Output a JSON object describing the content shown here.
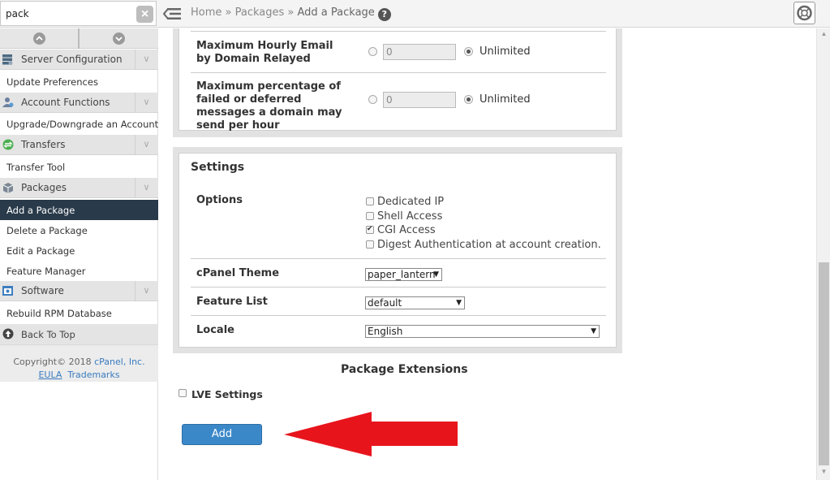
{
  "search": {
    "value": "pack",
    "clear_icon": "×"
  },
  "breadcrumb": {
    "home": "Home",
    "sep1": " » ",
    "packages": "Packages",
    "sep2": " » ",
    "current": "Add a Package",
    "help": "?"
  },
  "sidebar": {
    "categories": [
      {
        "label": "Server Configuration",
        "icon": "server-icon"
      },
      {
        "label": "Account Functions",
        "icon": "user-icon"
      },
      {
        "label": "Transfers",
        "icon": "transfer-icon"
      },
      {
        "label": "Packages",
        "icon": "package-icon"
      },
      {
        "label": "Software",
        "icon": "software-icon"
      }
    ],
    "items": {
      "update_preferences": "Update Preferences",
      "upgrade_downgrade": "Upgrade/Downgrade an Account",
      "transfer_tool": "Transfer Tool",
      "add_package": "Add a Package",
      "delete_package": "Delete a Package",
      "edit_package": "Edit a Package",
      "feature_manager": "Feature Manager",
      "rebuild_rpm": "Rebuild RPM Database"
    },
    "back_to_top": "Back To Top",
    "chevron": "∨",
    "footer": {
      "copyright": "Copyright© 2018 ",
      "company": "cPanel, Inc.",
      "eula": "EULA",
      "trademarks": "Trademarks"
    }
  },
  "email_limits": {
    "rows": [
      {
        "label": "Maximum Hourly Email by Domain Relayed",
        "value": "0",
        "option": "Unlimited"
      },
      {
        "label": "Maximum percentage of failed or deferred messages a domain may send per hour",
        "value": "0",
        "option": "Unlimited"
      }
    ]
  },
  "settings": {
    "title": "Settings",
    "options_label": "Options",
    "options": [
      {
        "label": "Dedicated IP",
        "checked": false
      },
      {
        "label": "Shell Access",
        "checked": false
      },
      {
        "label": "CGI Access",
        "checked": true
      },
      {
        "label": "Digest Authentication at account creation.",
        "checked": false
      }
    ],
    "theme_label": "cPanel Theme",
    "theme_value": "paper_lantern",
    "feature_list_label": "Feature List",
    "feature_list_value": "default",
    "locale_label": "Locale",
    "locale_value": "English"
  },
  "extensions": {
    "title": "Package Extensions",
    "lve_label": "LVE Settings"
  },
  "actions": {
    "add_label": "Add"
  },
  "annotation": {
    "arrow_color": "#e8141c"
  },
  "colors": {
    "accent": "#3b88c9",
    "active_nav": "#293a4a"
  }
}
